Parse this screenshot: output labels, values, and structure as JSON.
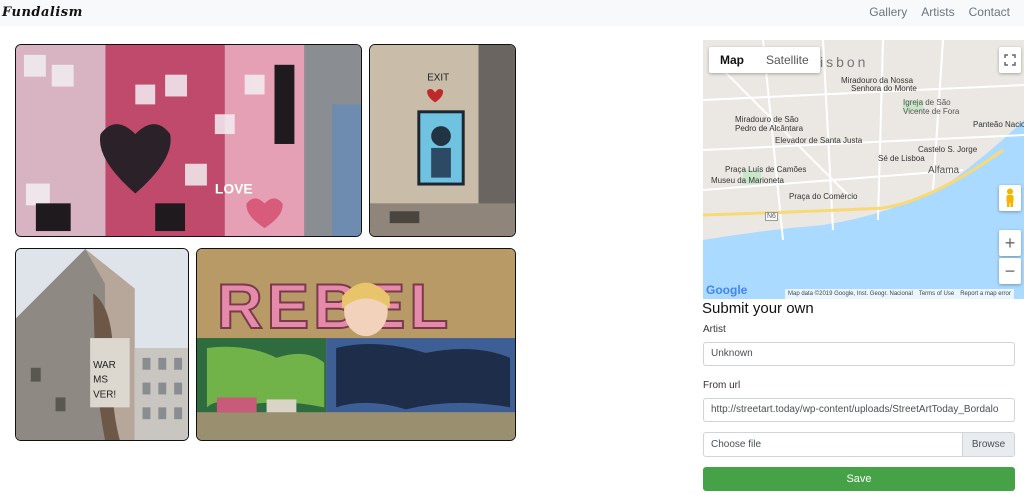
{
  "navbar": {
    "brand": "Fundalism",
    "links": [
      {
        "label": "Gallery"
      },
      {
        "label": "Artists"
      },
      {
        "label": "Contact"
      }
    ]
  },
  "map": {
    "tabs": [
      {
        "label": "Map",
        "active": true
      },
      {
        "label": "Satellite",
        "active": false
      }
    ],
    "city_label": "isbon",
    "places": [
      "Miradouro da Nossa",
      "Senhora do Monte",
      "Igreja de São",
      "Vicente de Fora",
      "Panteão Nacional",
      "Miradouro de São",
      "Pedro de Alcântara",
      "Elevador de Santa Justa",
      "Castelo S. Jorge",
      "Sé de Lisboa",
      "Alfama",
      "Praça Luís de Camões",
      "Museu da Marioneta",
      "Praça do Comércio",
      "N6"
    ],
    "footer": {
      "data": "Map data ©2019 Google, Inst. Geogr. Nacional",
      "terms": "Terms of Use",
      "report": "Report a map error"
    },
    "logo": "Google",
    "zoom_in": "+",
    "zoom_out": "−"
  },
  "form": {
    "title": "Submit your own",
    "artist_label": "Artist",
    "artist_value": "Unknown",
    "url_label": "From url",
    "url_value": "http://streetart.today/wp-content/uploads/StreetArtToday_Bordalo",
    "file_placeholder": "Choose file",
    "browse_label": "Browse",
    "save_label": "Save"
  },
  "gallery": {
    "photo4_text": "REBEL"
  },
  "colors": {
    "save": "#45a246",
    "water": "#aadaff",
    "navbar_bg": "#f8f9fa"
  }
}
